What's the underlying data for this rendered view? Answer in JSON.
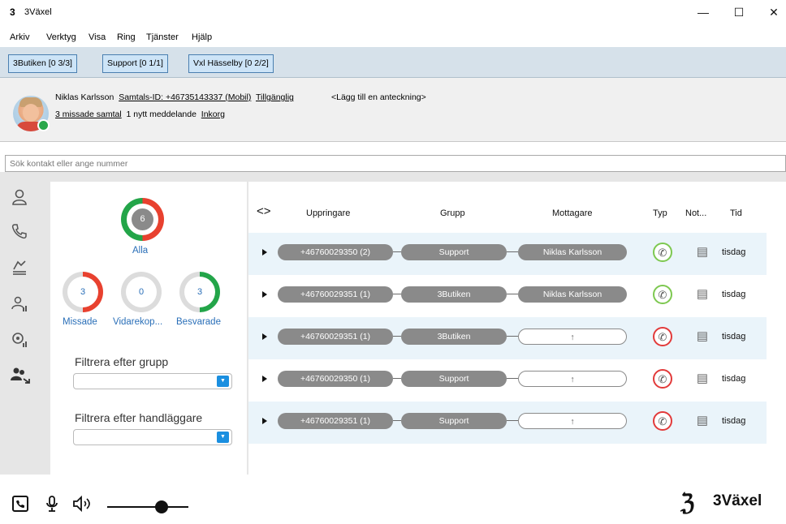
{
  "window": {
    "logo_glyph": "3",
    "title": "3Växel",
    "minimize": "—",
    "maximize": "☐",
    "close": "✕"
  },
  "menu": [
    "Arkiv",
    "Verktyg",
    "Visa",
    "Ring",
    "Tjänster",
    "Hjälp"
  ],
  "group_tabs": [
    "3Butiken [0 3/3]",
    "Support [0 1/1]",
    "Vxl Hässelby [0 2/2]"
  ],
  "profile": {
    "name": "Niklas Karlsson",
    "call_id": "Samtals-ID: +46735143337 (Mobil)",
    "availability": "Tillgänglig",
    "note_prompt": "<Lägg till en anteckning>",
    "missed_calls": "3 missade samtal",
    "messages": "1 nytt meddelande",
    "inbox": "Inkorg",
    "status_color": "#2aa84a"
  },
  "search": {
    "placeholder": "Sök kontakt eller ange nummer"
  },
  "sidenav": {
    "icons": [
      "contact-icon",
      "phone-icon",
      "call-list-icon",
      "queue-icon",
      "voicemail-icon",
      "group-transfer-icon"
    ]
  },
  "stats": {
    "all": {
      "value": "6",
      "label": "Alla",
      "missed": 3,
      "answered": 3
    },
    "missed": {
      "value": "3",
      "label": "Missade"
    },
    "forwarded": {
      "value": "0",
      "label": "Vidarekop..."
    },
    "answered": {
      "value": "3",
      "label": "Besvarade"
    },
    "colors": {
      "missed": "#e8412f",
      "answered": "#23a549",
      "forwarded": "#cfcfcf"
    }
  },
  "filters": {
    "group_label": "Filtrera efter grupp",
    "handler_label": "Filtrera efter handläggare",
    "dropdown_glyph": "▼"
  },
  "table": {
    "nav_glyph": "<>",
    "headers": [
      "Uppringare",
      "Grupp",
      "Mottagare",
      "Typ",
      "Not...",
      "Tid"
    ],
    "rows": [
      {
        "caller": "+46760029350 (2)",
        "group": "Support",
        "receiver": "Niklas Karlsson",
        "type": "answered",
        "time": "tisdag"
      },
      {
        "caller": "+46760029351 (1)",
        "group": "3Butiken",
        "receiver": "Niklas Karlsson",
        "type": "answered",
        "time": "tisdag"
      },
      {
        "caller": "+46760029351 (1)",
        "group": "3Butiken",
        "receiver": "↑",
        "type": "missed",
        "time": "tisdag"
      },
      {
        "caller": "+46760029350 (1)",
        "group": "Support",
        "receiver": "↑",
        "type": "missed",
        "time": "tisdag"
      },
      {
        "caller": "+46760029351 (1)",
        "group": "Support",
        "receiver": "↑",
        "type": "missed",
        "time": "tisdag"
      }
    ],
    "phone_glyph": "✆",
    "note_glyph": "▤"
  },
  "footer": {
    "volume_level": 0.7,
    "brand_mark": "ℨ",
    "brand": "3Växel"
  }
}
